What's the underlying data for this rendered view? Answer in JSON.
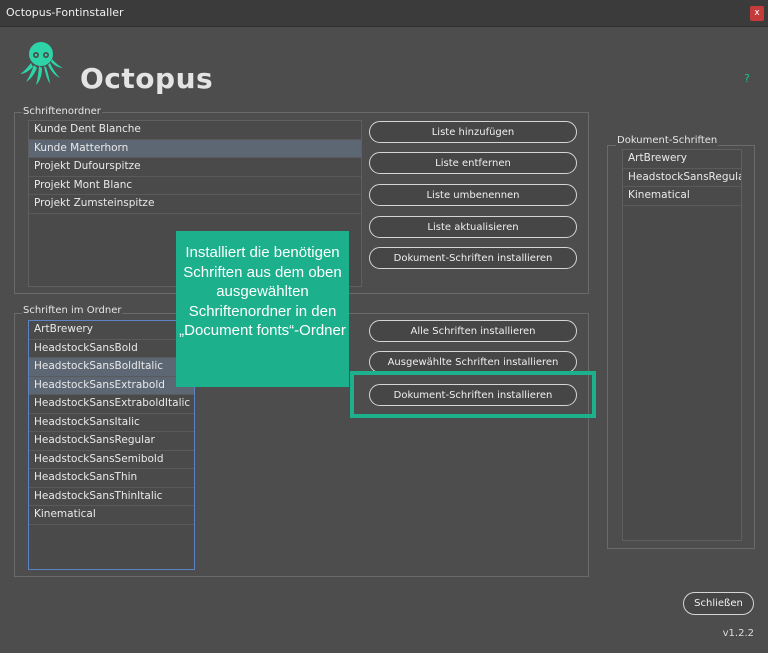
{
  "window": {
    "title": "Octopus-Fontinstaller",
    "close_label": "x"
  },
  "header": {
    "brand": "Octopus",
    "help": "?"
  },
  "font_folders": {
    "legend": "Schriftenordner",
    "items": [
      "Kunde Dent Blanche",
      "Kunde Matterhorn",
      "Projekt Dufourspitze",
      "Projekt Mont Blanc",
      "Projekt Zumsteinspitze"
    ],
    "selected": "Kunde Matterhorn"
  },
  "list_buttons": {
    "add": "Liste hinzufügen",
    "remove": "Liste entfernen",
    "rename": "Liste umbenennen",
    "refresh": "Liste aktualisieren",
    "install_document": "Dokument-Schriften installieren"
  },
  "fonts_in_folder": {
    "legend": "Schriften im Ordner",
    "items": [
      "ArtBrewery",
      "HeadstockSansBold",
      "HeadstockSansBoldItalic",
      "HeadstockSansExtrabold",
      "HeadstockSansExtraboldItalic",
      "HeadstockSansItalic",
      "HeadstockSansRegular",
      "HeadstockSansSemibold",
      "HeadstockSansThin",
      "HeadstockSansThinItalic",
      "Kinematical"
    ],
    "selected": [
      "HeadstockSansBoldItalic",
      "HeadstockSansExtrabold"
    ]
  },
  "font_buttons": {
    "install_all": "Alle Schriften installieren",
    "install_selected": "Ausgewählte Schriften installieren",
    "install_document": "Dokument-Schriften installieren"
  },
  "document_fonts": {
    "legend": "Dokument-Schriften",
    "items": [
      "ArtBrewery",
      "HeadstockSansRegular",
      "Kinematical"
    ]
  },
  "tooltip": {
    "text": "Installiert die benötigen Schriften aus dem oben ausgewählten Schriftenordner in den „Document fonts“-Ordner"
  },
  "footer": {
    "close_label": "Schließen",
    "version": "v1.2.2"
  },
  "colors": {
    "accent": "#1cb08d",
    "background": "#4d4d4d",
    "selection": "#5d6673"
  }
}
